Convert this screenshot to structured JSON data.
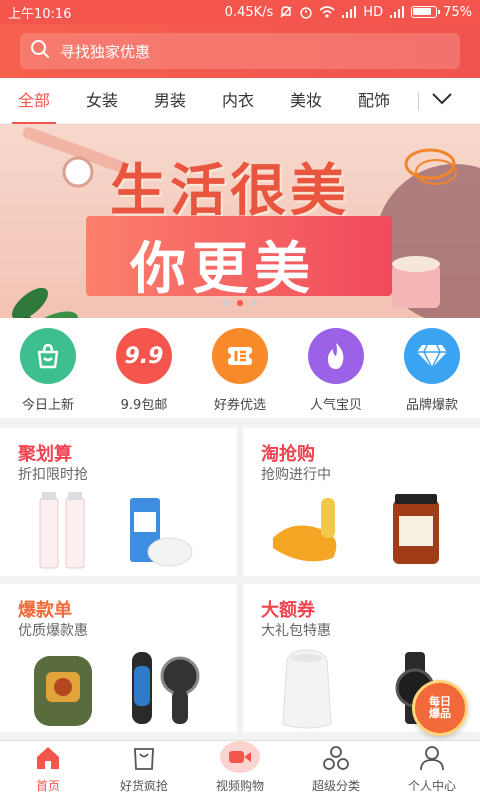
{
  "status_bar": {
    "time": "上午10:16",
    "network_speed": "0.45K/s",
    "signal_label": "HD",
    "battery": "75%"
  },
  "search": {
    "placeholder": "寻找独家优惠",
    "icon": "search-icon"
  },
  "categories": {
    "tabs": [
      "全部",
      "女装",
      "男装",
      "内衣",
      "美妆",
      "配饰"
    ],
    "active_index": 0,
    "more_icon": "chevron-down-icon"
  },
  "banner": {
    "line1": "生活很美",
    "line2": "你更美",
    "dots": 3,
    "active_dot": 1
  },
  "shortcuts": [
    {
      "label": "今日上新",
      "icon": "shopping-bag-icon",
      "color": "#3dbf8f"
    },
    {
      "label": "9.9包邮",
      "icon": "nine-nine-icon",
      "color": "#f4564e",
      "badge": "9.9"
    },
    {
      "label": "好券优选",
      "icon": "coupon-icon",
      "color": "#f98a2a"
    },
    {
      "label": "人气宝贝",
      "icon": "flame-icon",
      "color": "#9b62e8"
    },
    {
      "label": "品牌爆款",
      "icon": "diamond-icon",
      "color": "#3aa3f2"
    }
  ],
  "promos": [
    {
      "title": "聚划算",
      "subtitle": "折扣限时抢",
      "title_color": "#f0434f"
    },
    {
      "title": "淘抢购",
      "subtitle": "抢购进行中",
      "title_color": "#f0434f"
    },
    {
      "title": "爆款单",
      "subtitle": "优质爆款惠",
      "title_color": "#f26a3a"
    },
    {
      "title": "大额券",
      "subtitle": "大礼包特惠",
      "title_color": "#f0434f"
    }
  ],
  "floating_badge": {
    "line1": "每日",
    "line2": "爆品"
  },
  "bottom_nav": [
    {
      "label": "首页",
      "icon": "home-icon",
      "active": true
    },
    {
      "label": "好货疯抢",
      "icon": "bag-icon",
      "active": false
    },
    {
      "label": "视频购物",
      "icon": "video-icon",
      "active": false
    },
    {
      "label": "超级分类",
      "icon": "category-icon",
      "active": false
    },
    {
      "label": "个人中心",
      "icon": "user-icon",
      "active": false
    }
  ],
  "colors": {
    "primary": "#f4564e",
    "text": "#333333"
  }
}
